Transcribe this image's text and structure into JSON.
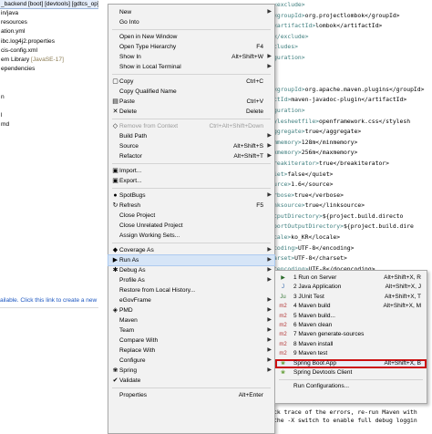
{
  "explorer": {
    "title": "_backend [boot] [devtools] [gdtcs_op]",
    "lines": [
      {
        "text": "in/java",
        "suffix": ""
      },
      {
        "text": "resources",
        "suffix": ""
      },
      {
        "text": "ation.yml",
        "suffix": ""
      },
      {
        "text": "ibc.log4j2.properties",
        "suffix": ""
      },
      {
        "text": "cis-config.xml",
        "suffix": ""
      },
      {
        "text": "em Library ",
        "suffix": "[JavaSE-17]"
      },
      {
        "text": "ependencies",
        "suffix": ""
      },
      {
        "text": "",
        "suffix": ""
      },
      {
        "text": "",
        "suffix": ""
      },
      {
        "text": "n",
        "suffix": ""
      },
      {
        "text": "",
        "suffix": ""
      },
      {
        "text": "l",
        "suffix": ""
      },
      {
        "text": "md",
        "suffix": ""
      }
    ],
    "link_text": "ailable. Click this link to create a new"
  },
  "editor": {
    "lines": [
      {
        "tag": "<exclude>",
        "text": ""
      },
      {
        "tag": "<groupId>",
        "text": "org.projectlombok</groupId>"
      },
      {
        "tag": "<artifactId>",
        "text": "lombok</artifactId>"
      },
      {
        "tag": "</exclude>",
        "text": ""
      },
      {
        "tag": "cludes>",
        "text": ""
      },
      {
        "tag": "guration>",
        "text": ""
      },
      {
        "tag": "",
        "text": ""
      },
      {
        "tag": "",
        "text": ""
      },
      {
        "tag": "<groupId>",
        "text": "org.apache.maven.plugins</groupId>"
      },
      {
        "tag": "ctId>",
        "text": "maven-javadoc-plugin</artifactId>"
      },
      {
        "tag": "guration>",
        "text": ""
      },
      {
        "tag": "ylesheetfile>",
        "text": "openframework.css</stylesh"
      },
      {
        "tag": "ggregate>",
        "text": "true</aggregate>"
      },
      {
        "tag": "mmemory>",
        "text": "128m</minmemory>"
      },
      {
        "tag": "xmemory>",
        "text": "256m</maxmemory>"
      },
      {
        "tag": "reakiterator>",
        "text": "true</breakiterator>"
      },
      {
        "tag": "iet>",
        "text": "false</quiet>"
      },
      {
        "tag": "urce>",
        "text": "1.6</source>"
      },
      {
        "tag": "rbose>",
        "text": "true</verbose>"
      },
      {
        "tag": "nksource>",
        "text": "true</linksource>"
      },
      {
        "tag": "tputDirectory>",
        "text": "${project.build.directo"
      },
      {
        "tag": "portOutputDirectory>",
        "text": "${project.build.dire"
      },
      {
        "tag": "cale>",
        "text": "ko_KR</locale>"
      },
      {
        "tag": "coding>",
        "text": "UTF-8</encoding>"
      },
      {
        "tag": "arset>",
        "text": "UTF-8</charset>"
      },
      {
        "tag": "cencoding>",
        "text": "UTF-8</docencoding>"
      }
    ],
    "console": [
      "ck trace of the errors, re-run Maven with",
      "the -X switch to enable full debug loggin"
    ]
  },
  "context_menu": {
    "items": [
      {
        "type": "item",
        "icon": "",
        "icon_name": "",
        "label": "New",
        "shortcut": "",
        "submenu": true,
        "disabled": false
      },
      {
        "type": "item",
        "icon": "",
        "icon_name": "",
        "label": "Go Into",
        "shortcut": "",
        "submenu": false,
        "disabled": false
      },
      {
        "type": "sep"
      },
      {
        "type": "item",
        "icon": "",
        "icon_name": "",
        "label": "Open in New Window",
        "shortcut": "",
        "submenu": false,
        "disabled": false
      },
      {
        "type": "item",
        "icon": "",
        "icon_name": "",
        "label": "Open Type Hierarchy",
        "shortcut": "F4",
        "submenu": false,
        "disabled": false
      },
      {
        "type": "item",
        "icon": "",
        "icon_name": "",
        "label": "Show In",
        "shortcut": "Alt+Shift+W",
        "submenu": true,
        "disabled": false
      },
      {
        "type": "item",
        "icon": "",
        "icon_name": "",
        "label": "Show in Local Terminal",
        "shortcut": "",
        "submenu": true,
        "disabled": false
      },
      {
        "type": "sep"
      },
      {
        "type": "item",
        "icon": "▢",
        "icon_name": "copy-icon",
        "label": "Copy",
        "shortcut": "Ctrl+C",
        "submenu": false,
        "disabled": false
      },
      {
        "type": "item",
        "icon": "",
        "icon_name": "",
        "label": "Copy Qualified Name",
        "shortcut": "",
        "submenu": false,
        "disabled": false
      },
      {
        "type": "item",
        "icon": "▤",
        "icon_name": "paste-icon",
        "label": "Paste",
        "shortcut": "Ctrl+V",
        "submenu": false,
        "disabled": false
      },
      {
        "type": "item",
        "icon": "✕",
        "icon_name": "delete-icon",
        "label": "Delete",
        "shortcut": "Delete",
        "submenu": false,
        "disabled": false
      },
      {
        "type": "sep"
      },
      {
        "type": "item",
        "icon": "◇",
        "icon_name": "remove-from-context-icon",
        "label": "Remove from Context",
        "shortcut": "Ctrl+Alt+Shift+Down",
        "submenu": false,
        "disabled": true
      },
      {
        "type": "item",
        "icon": "",
        "icon_name": "",
        "label": "Build Path",
        "shortcut": "",
        "submenu": true,
        "disabled": false
      },
      {
        "type": "item",
        "icon": "",
        "icon_name": "",
        "label": "Source",
        "shortcut": "Alt+Shift+S",
        "submenu": true,
        "disabled": false
      },
      {
        "type": "item",
        "icon": "",
        "icon_name": "",
        "label": "Refactor",
        "shortcut": "Alt+Shift+T",
        "submenu": true,
        "disabled": false
      },
      {
        "type": "sep"
      },
      {
        "type": "item",
        "icon": "▣",
        "icon_name": "import-icon",
        "label": "Import...",
        "shortcut": "",
        "submenu": false,
        "disabled": false
      },
      {
        "type": "item",
        "icon": "▣",
        "icon_name": "export-icon",
        "label": "Export...",
        "shortcut": "",
        "submenu": false,
        "disabled": false
      },
      {
        "type": "sep"
      },
      {
        "type": "item",
        "icon": "●",
        "icon_name": "spotbugs-icon",
        "label": "SpotBugs",
        "shortcut": "",
        "submenu": true,
        "disabled": false
      },
      {
        "type": "item",
        "icon": "↻",
        "icon_name": "refresh-icon",
        "label": "Refresh",
        "shortcut": "F5",
        "submenu": false,
        "disabled": false
      },
      {
        "type": "item",
        "icon": "",
        "icon_name": "",
        "label": "Close Project",
        "shortcut": "",
        "submenu": false,
        "disabled": false
      },
      {
        "type": "item",
        "icon": "",
        "icon_name": "",
        "label": "Close Unrelated Project",
        "shortcut": "",
        "submenu": false,
        "disabled": false
      },
      {
        "type": "item",
        "icon": "",
        "icon_name": "",
        "label": "Assign Working Sets...",
        "shortcut": "",
        "submenu": false,
        "disabled": false
      },
      {
        "type": "sep"
      },
      {
        "type": "item",
        "icon": "◆",
        "icon_name": "coverage-icon",
        "label": "Coverage As",
        "shortcut": "",
        "submenu": true,
        "disabled": false
      },
      {
        "type": "item",
        "icon": "▶",
        "icon_name": "run-icon",
        "label": "Run As",
        "shortcut": "",
        "submenu": true,
        "disabled": false,
        "highlight": true
      },
      {
        "type": "item",
        "icon": "✱",
        "icon_name": "debug-icon",
        "label": "Debug As",
        "shortcut": "",
        "submenu": true,
        "disabled": false
      },
      {
        "type": "item",
        "icon": "",
        "icon_name": "",
        "label": "Profile As",
        "shortcut": "",
        "submenu": true,
        "disabled": false
      },
      {
        "type": "item",
        "icon": "",
        "icon_name": "",
        "label": "Restore from Local History...",
        "shortcut": "",
        "submenu": false,
        "disabled": false
      },
      {
        "type": "item",
        "icon": "",
        "icon_name": "",
        "label": "eGovFrame",
        "shortcut": "",
        "submenu": true,
        "disabled": false
      },
      {
        "type": "item",
        "icon": "◈",
        "icon_name": "pmd-icon",
        "label": "PMD",
        "shortcut": "",
        "submenu": true,
        "disabled": false
      },
      {
        "type": "item",
        "icon": "",
        "icon_name": "",
        "label": "Maven",
        "shortcut": "",
        "submenu": true,
        "disabled": false
      },
      {
        "type": "item",
        "icon": "",
        "icon_name": "",
        "label": "Team",
        "shortcut": "",
        "submenu": true,
        "disabled": false
      },
      {
        "type": "item",
        "icon": "",
        "icon_name": "",
        "label": "Compare With",
        "shortcut": "",
        "submenu": true,
        "disabled": false
      },
      {
        "type": "item",
        "icon": "",
        "icon_name": "",
        "label": "Replace With",
        "shortcut": "",
        "submenu": true,
        "disabled": false
      },
      {
        "type": "item",
        "icon": "",
        "icon_name": "",
        "label": "Configure",
        "shortcut": "",
        "submenu": true,
        "disabled": false
      },
      {
        "type": "item",
        "icon": "❀",
        "icon_name": "spring-icon",
        "label": "Spring",
        "shortcut": "",
        "submenu": true,
        "disabled": false
      },
      {
        "type": "item",
        "icon": "✔",
        "icon_name": "validate-icon",
        "label": "Validate",
        "shortcut": "",
        "submenu": false,
        "disabled": false
      },
      {
        "type": "sep"
      },
      {
        "type": "item",
        "icon": "",
        "icon_name": "",
        "label": "Properties",
        "shortcut": "Alt+Enter",
        "submenu": false,
        "disabled": false
      }
    ]
  },
  "run_as_submenu": {
    "items": [
      {
        "type": "item",
        "icon": "▶",
        "icon_name": "server-icon",
        "label": "1 Run on Server",
        "shortcut": "Alt+Shift+X, R"
      },
      {
        "type": "item",
        "icon": "J",
        "icon_name": "java-app-icon",
        "label": "2 Java Application",
        "shortcut": "Alt+Shift+X, J"
      },
      {
        "type": "item",
        "icon": "Ju",
        "icon_name": "junit-icon",
        "label": "3 JUnit Test",
        "shortcut": "Alt+Shift+X, T"
      },
      {
        "type": "item",
        "icon": "m2",
        "icon_name": "maven-icon",
        "label": "4 Maven build",
        "shortcut": "Alt+Shift+X, M"
      },
      {
        "type": "item",
        "icon": "m2",
        "icon_name": "maven-icon",
        "label": "5 Maven build...",
        "shortcut": ""
      },
      {
        "type": "item",
        "icon": "m2",
        "icon_name": "maven-icon",
        "label": "6 Maven clean",
        "shortcut": ""
      },
      {
        "type": "item",
        "icon": "m2",
        "icon_name": "maven-icon",
        "label": "7 Maven generate-sources",
        "shortcut": ""
      },
      {
        "type": "item",
        "icon": "m2",
        "icon_name": "maven-icon",
        "label": "8 Maven install",
        "shortcut": ""
      },
      {
        "type": "item",
        "icon": "m2",
        "icon_name": "maven-icon",
        "label": "9 Maven test",
        "shortcut": ""
      },
      {
        "type": "item",
        "icon": "❀",
        "icon_name": "spring-boot-icon",
        "label": "Spring Boot App",
        "shortcut": "Alt+Shift+X, B",
        "selected": true
      },
      {
        "type": "item",
        "icon": "❀",
        "icon_name": "spring-devtools-icon",
        "label": "Spring Devtools Client",
        "shortcut": ""
      },
      {
        "type": "sep"
      },
      {
        "type": "item",
        "icon": "",
        "icon_name": "",
        "label": "Run Configurations...",
        "shortcut": ""
      }
    ]
  },
  "colors": {
    "highlight_outline": "#cc1111",
    "menu_bg": "#f2f2f2",
    "link": "#1a55c0",
    "xml_tag": "#3f7f7f"
  }
}
